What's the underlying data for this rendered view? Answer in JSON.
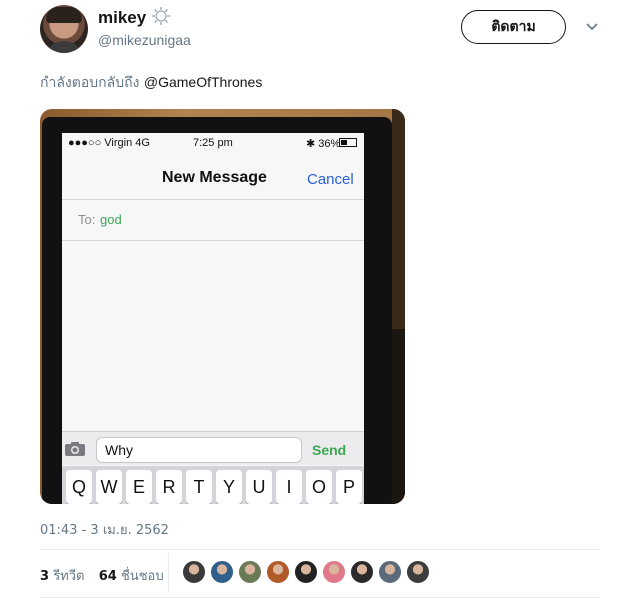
{
  "user": {
    "name": "mikey",
    "handle": "@mikezunigaa"
  },
  "follow_button": {
    "label": "ติดตาม"
  },
  "reply": {
    "prefix": "กำลังตอบกลับถึง",
    "mention": "@GameOfThrones"
  },
  "media": {
    "statusbar": {
      "carrier": "●●●○○ Virgin  4G",
      "time": "7:25 pm",
      "battery": "✱ 36%"
    },
    "nav": {
      "title": "New Message",
      "cancel": "Cancel"
    },
    "to": {
      "label": "To:",
      "value": "god"
    },
    "compose": {
      "text": "Why",
      "send": "Send"
    },
    "keyboard": [
      "Q",
      "W",
      "E",
      "R",
      "T",
      "Y",
      "U",
      "I",
      "O",
      "P"
    ]
  },
  "timestamp": "01:43 - 3 เม.ย. 2562",
  "stats": {
    "retweets_count": "3",
    "retweets_label": "รีทวีต",
    "likes_count": "64",
    "likes_label": "ชื่นชอบ"
  },
  "colors": {
    "likers": [
      "#3a3a3a",
      "#2f5f8a",
      "#6a7a55",
      "#b05a2a",
      "#222222",
      "#e07a8a",
      "#2a2a2a",
      "#5a6a7a",
      "#3c3c3c"
    ]
  }
}
